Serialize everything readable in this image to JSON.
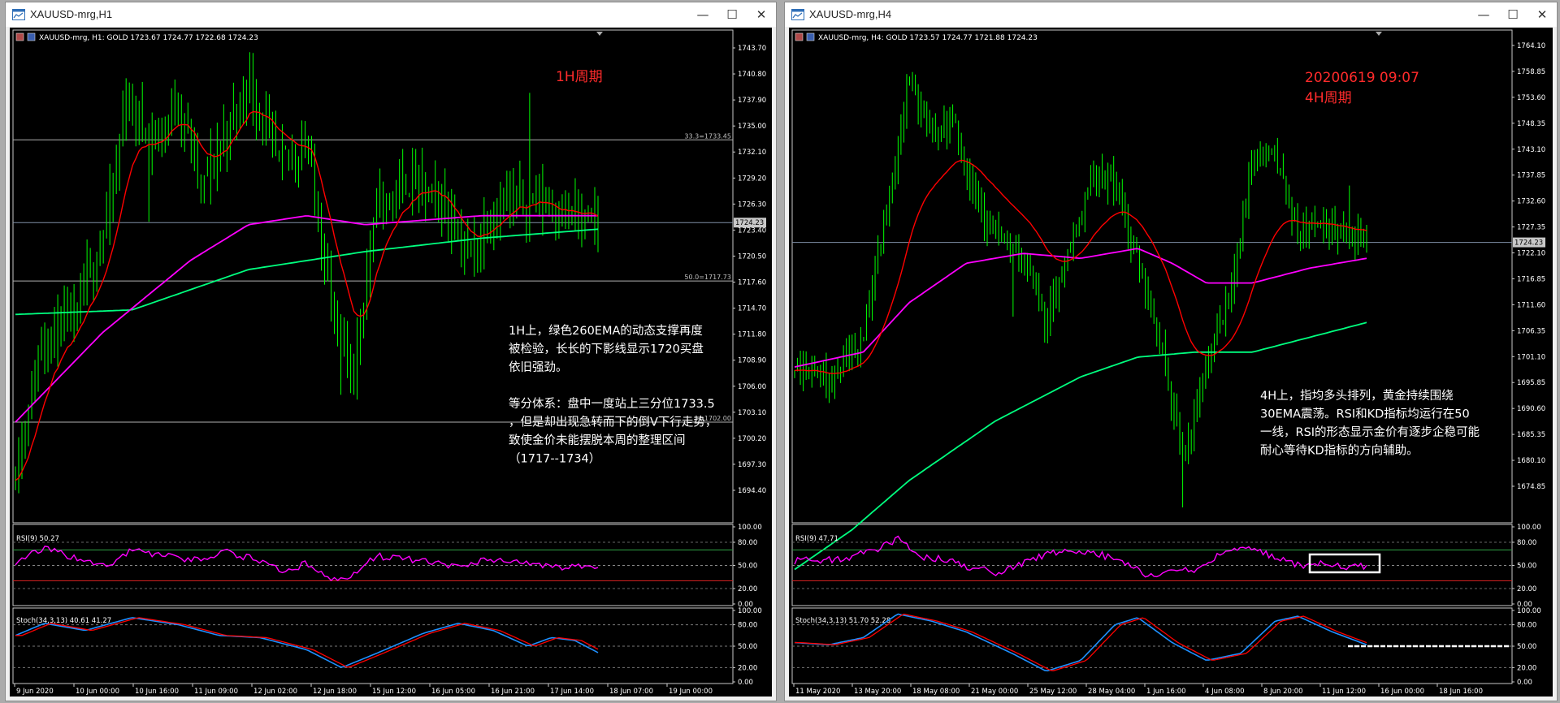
{
  "windows": [
    {
      "key": "h1",
      "title": "XAUUSD-mrg,H1",
      "header": "XAUUSD-mrg, H1:  GOLD  1723.67 1724.77 1722.68 1724.23",
      "period_label": "1H周期",
      "date_label": "",
      "price_axis": [
        "1743.70",
        "1740.80",
        "1737.90",
        "1735.00",
        "1732.10",
        "1729.20",
        "1726.30",
        "1723.40",
        "1720.50",
        "1717.60",
        "1714.70",
        "1711.80",
        "1708.90",
        "1706.00",
        "1703.10",
        "1700.20",
        "1697.30",
        "1694.40"
      ],
      "current_price": "1724.23",
      "levels": [
        {
          "label": "33.3=1733.45",
          "price": 1733.45
        },
        {
          "label": "50.0=1717.73",
          "price": 1717.73
        },
        {
          "label": "=1702.00",
          "price": 1702.0
        }
      ],
      "annotation": [
        "1H上，绿色260EMA的动态支撑再度",
        "被检验，长长的下影线显示1720买盘",
        "依旧强劲。",
        "",
        "等分体系：盘中一度站上三分位1733.5",
        "，但是却出现急转而下的倒V下行走势，",
        "致使金价未能摆脱本周的整理区间",
        "（1717--1734）"
      ],
      "rsi_label": "RSI(9) 50.27",
      "rsi_axis": [
        "100.00",
        "80.00",
        "50.00",
        "20.00",
        "0.00"
      ],
      "stoch_label": "Stoch(34,3,13) 40.61 41.27",
      "stoch_axis": [
        "100.00",
        "80.00",
        "50.00",
        "20.00",
        "0.00"
      ],
      "time_axis": [
        "9 Jun 2020",
        "10 Jun 00:00",
        "10 Jun 16:00",
        "11 Jun 09:00",
        "12 Jun 02:00",
        "12 Jun 18:00",
        "15 Jun 12:00",
        "16 Jun 05:00",
        "16 Jun 21:00",
        "17 Jun 14:00",
        "18 Jun 07:00",
        "19 Jun 00:00"
      ]
    },
    {
      "key": "h4",
      "title": "XAUUSD-mrg,H4",
      "header": "XAUUSD-mrg, H4:  GOLD  1723.57 1724.77 1721.88 1724.23",
      "period_label": "4H周期",
      "date_label": "20200619 09:07",
      "price_axis": [
        "1764.10",
        "1758.85",
        "1753.60",
        "1748.35",
        "1743.10",
        "1737.85",
        "1732.60",
        "1727.35",
        "1722.10",
        "1716.85",
        "1711.60",
        "1706.35",
        "1701.10",
        "1695.85",
        "1690.60",
        "1685.35",
        "1680.10",
        "1674.85"
      ],
      "current_price": "1724.23",
      "levels": [],
      "annotation": [
        "4H上，指均多头排列，黄金持续围绕",
        "30EMA震荡。RSI和KD指标均运行在50",
        "一线，RSI的形态显示金价有逐步企稳可能",
        "耐心等待KD指标的方向辅助。"
      ],
      "rsi_label": "RSI(9) 47.71",
      "rsi_axis": [
        "100.00",
        "80.00",
        "50.00",
        "20.00",
        "0.00"
      ],
      "stoch_label": "Stoch(34,3,13) 51.70 52.28",
      "stoch_axis": [
        "100.00",
        "80.00",
        "50.00",
        "20.00",
        "0.00"
      ],
      "time_axis": [
        "11 May 2020",
        "13 May 20:00",
        "18 May 08:00",
        "21 May 00:00",
        "25 May 12:00",
        "28 May 04:00",
        "1 Jun 16:00",
        "4 Jun 08:00",
        "8 Jun 20:00",
        "11 Jun 12:00",
        "16 Jun 00:00",
        "18 Jun 16:00"
      ]
    }
  ],
  "window_buttons": {
    "minimize": "—",
    "maximize": "☐",
    "close": "✕"
  },
  "colors": {
    "candles": "#00ff00",
    "ema_fast": "#ff0000",
    "ema_mid": "#ff00ff",
    "ema_slow": "#00ff7f",
    "rsi": "#ff00ff",
    "stoch_main": "#1e90ff",
    "stoch_signal": "#ff0000",
    "annotation_red": "#ff2b2b"
  }
}
